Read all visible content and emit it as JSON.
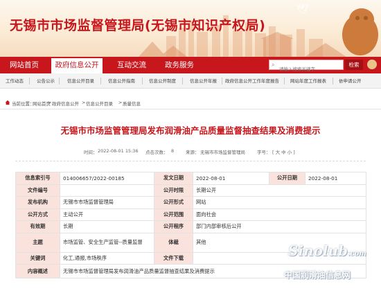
{
  "header": {
    "site_title": "无锡市市场监督管理局(无锡市知识产权局)"
  },
  "nav": {
    "items": [
      {
        "label": "网站首页"
      },
      {
        "label": "政府信息公开"
      },
      {
        "label": "互动交流"
      },
      {
        "label": "政务服务"
      }
    ],
    "active_index": 1,
    "search_placeholder": "请输入搜索关键字",
    "search_button": "检索"
  },
  "subnav": {
    "items": [
      {
        "label": "工作动态"
      },
      {
        "label": "公告公示"
      },
      {
        "label": "信息公开目录"
      },
      {
        "label": "信息公开指南"
      },
      {
        "label": "信息公开制度"
      },
      {
        "label": "信息公开年报"
      },
      {
        "label": "政府信息公开工作年度报告"
      },
      {
        "label": "网站年度工作报表"
      },
      {
        "label": "依申请公开"
      }
    ]
  },
  "breadcrumb": {
    "prefix": "当前位置：",
    "items": [
      "网站首页",
      "政府信息公开",
      "信息公开目录",
      "质量信息"
    ],
    "separator": ">"
  },
  "article": {
    "title": "无锡市市场监管管理局发布润滑油产品质量监督抽查结果及消费提示",
    "time_label": "时间：",
    "time": "2022-08-01 15:36",
    "views_label": "点击次数：",
    "views": "8",
    "source_label": "来源：",
    "source": "无锡市市场监督管理局",
    "fontsize_label": "字号：",
    "fontsize_options": "[ 大 中 小 ]"
  },
  "info": {
    "index_label": "信息索引号",
    "index_value": "014006657/2022-00185",
    "date_label": "发文日期",
    "date_value": "2022-08-01",
    "pubdate_label": "公开日期",
    "pubdate_value": "2022-08-01",
    "docno_label": "文件编号",
    "docno_value": "",
    "period_label": "公开时限",
    "period_value": "长期公开",
    "org_label": "发布机构",
    "org_value": "无锡市市场监督管理局",
    "form_label": "公开形式",
    "form_value": "网站",
    "method_label": "公开方式",
    "method_value": "主动公开",
    "scope_label": "公开范围",
    "scope_value": "面向社会",
    "validity_label": "有效期",
    "validity_value": "长期",
    "procedure_label": "公开程序",
    "procedure_value": "部门内部审核后公开",
    "topic_label": "主题",
    "topic_value": "市场监管、安全生产监管--质量监督",
    "genre_label": "体裁",
    "genre_value": "其他",
    "keywords_label": "关键词",
    "keywords_value": "化工,通报,市场秩序",
    "download_label": "文件下载",
    "download_value": "",
    "summary_label": "内容概述",
    "summary_value": "无锡市市场监督管理局发布润滑油产品质量监督抽查结果及消费提示"
  },
  "watermark": {
    "logo": "Sinolub",
    "domain": ".com",
    "text": "中国润滑油信息网"
  },
  "colors": {
    "brand_red": "#c8161d",
    "label_bg": "#fae3dc"
  }
}
